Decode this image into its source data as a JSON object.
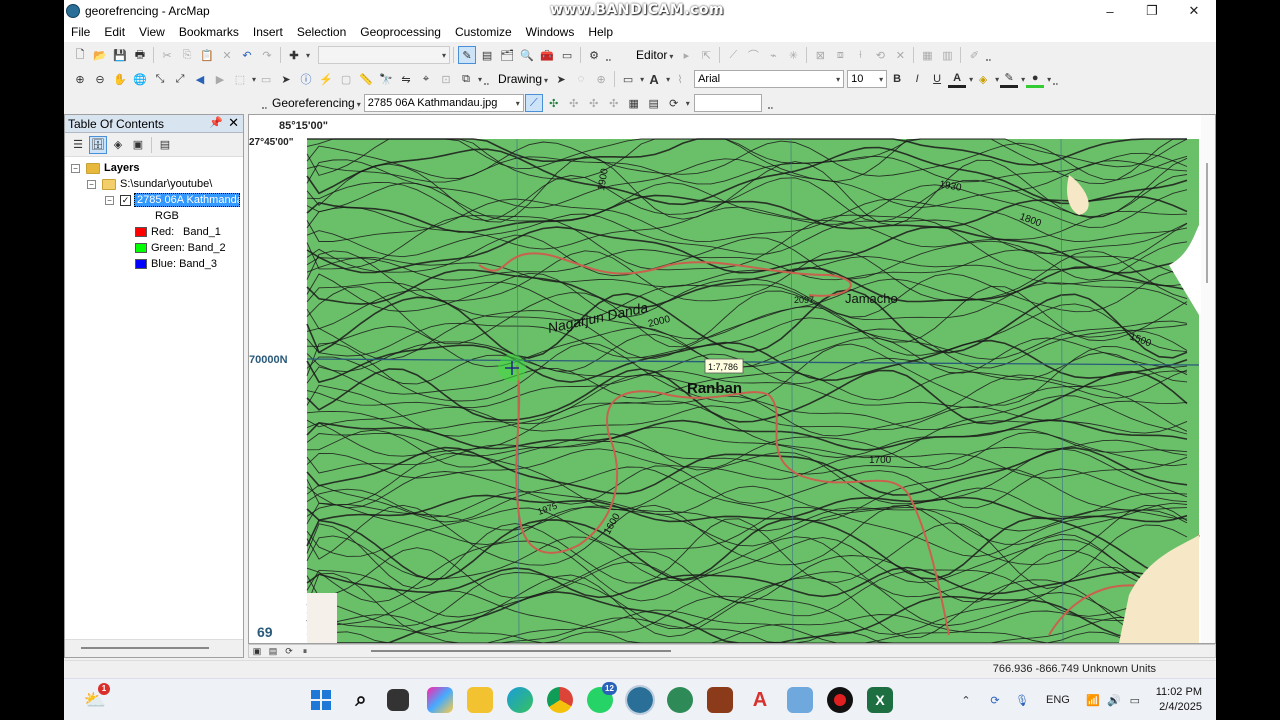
{
  "window": {
    "title": "georefrencing - ArcMap",
    "watermark": "www.BANDICAM.com",
    "controls": [
      "–",
      "❐",
      "✕"
    ]
  },
  "menu": [
    "File",
    "Edit",
    "View",
    "Bookmarks",
    "Insert",
    "Selection",
    "Geoprocessing",
    "Customize",
    "Windows",
    "Help"
  ],
  "toolbar": {
    "editor_label": "Editor",
    "drawing_label": "Drawing",
    "font_name": "Arial",
    "font_size": "10",
    "bold": "B",
    "italic": "I",
    "underline": "U",
    "georeferencing_label": "Georeferencing",
    "georef_layer": "2785 06A Kathmandau.jpg"
  },
  "toc": {
    "title": "Table Of Contents",
    "layers_label": "Layers",
    "folder_path": "S:\\sundar\\youtube\\",
    "layer_name": "2785 06A Kathmandau",
    "rgb_label": "RGB",
    "bands": [
      {
        "label": "Red:",
        "band": "Band_1",
        "color": "#ff0000"
      },
      {
        "label": "Green:",
        "band": "Band_2",
        "color": "#00ff00"
      },
      {
        "label": "Blue:",
        "band": "Band_3",
        "color": "#0000ff"
      }
    ]
  },
  "map": {
    "lon_label": "85°15'00\"",
    "lat_label": "27°45'00\"",
    "northing_label": "70000N",
    "bottom_label": "69",
    "scale_tip": "1:7,786",
    "place_names": [
      "Ranban",
      "Jamacho",
      "Nagarjun Danda"
    ],
    "contour_labels": [
      "2000",
      "1900",
      "1800",
      "1700",
      "1600",
      "1500",
      "1930",
      "1975",
      "2097"
    ],
    "map_green": "#6abf69",
    "contour_color": "#1a1a1a",
    "road_color": "#c9614f"
  },
  "status": {
    "coordinates": "766.936  -866.749 Unknown Units"
  },
  "taskbar": {
    "notification_badge": "1",
    "whatsapp_badge": "12",
    "lang": "ENG",
    "time": "11:02 PM",
    "date": "2/4/2025"
  }
}
